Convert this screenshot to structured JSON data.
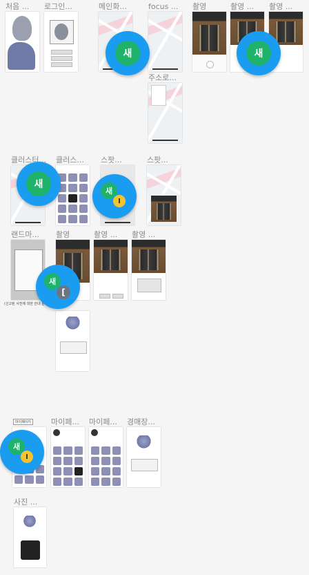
{
  "frames": {
    "first": "처음 ...",
    "login": "로그인...",
    "main": "메인화...",
    "focus": "focus ...",
    "shoot1": "촬영",
    "shoot2": "촬영 ...",
    "shoot3": "촬영 ...",
    "address": "주소로...",
    "cluster1": "클러스터...",
    "cluster2": "클러스...",
    "spot1": "스팟...",
    "spot2": "스팟...",
    "landmark": "랜드마...",
    "shoot4": "촬영",
    "shoot5": "촬영 ...",
    "shoot6": "촬영 ...",
    "mypage1": "마이페...",
    "mypage2": "마이페...",
    "mypage3": "마이페...",
    "auction": "경매장...",
    "photo": "사진 ..."
  },
  "overlay": {
    "my_page_tag": "마이페이지",
    "new_marker": "새",
    "coin_marker": "I",
    "cursor_marker": "["
  },
  "mini_text": {
    "footer_note": "(신고된 사진에 대한 안내 문구)"
  },
  "colors": {
    "badge_blue": "#1a9cf0",
    "badge_green": "#1fb26b",
    "badge_yellow": "#f4c430"
  }
}
